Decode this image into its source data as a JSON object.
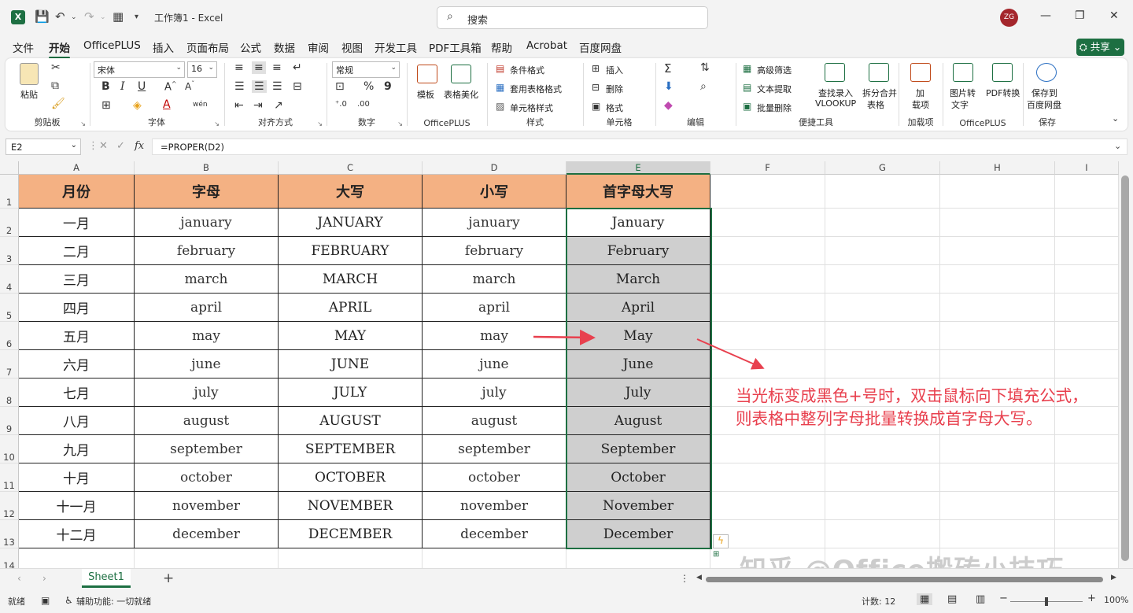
{
  "app": {
    "title": "工作簿1  -  Excel",
    "avatar": "ZG",
    "search_placeholder": "搜索"
  },
  "menus": [
    "文件",
    "开始",
    "OfficePLUS",
    "插入",
    "页面布局",
    "公式",
    "数据",
    "审阅",
    "视图",
    "开发工具",
    "PDF工具箱",
    "帮助",
    "Acrobat",
    "百度网盘"
  ],
  "share_label": "共享",
  "ribbon": {
    "clipboard": {
      "paste": "粘贴",
      "label": "剪贴板"
    },
    "font": {
      "name": "宋体",
      "size": "16",
      "label": "字体"
    },
    "align": {
      "label": "对齐方式"
    },
    "number": {
      "format": "常规",
      "label": "数字"
    },
    "officeplus": {
      "template": "模板",
      "beautify": "表格美化",
      "label": "OfficePLUS"
    },
    "style": {
      "cond": "条件格式",
      "table": "套用表格格式",
      "cell": "单元格样式",
      "label": "样式"
    },
    "cells": {
      "insert": "插入",
      "delete": "删除",
      "format": "格式",
      "label": "单元格"
    },
    "edit": {
      "label": "编辑"
    },
    "tools": {
      "advfilter": "高级筛选",
      "textextract": "文本提取",
      "batchdelete": "批量删除",
      "lookup1": "查找录入",
      "lookup2": "VLOOKUP",
      "split1": "拆分合并",
      "split2": "表格",
      "label": "便捷工具"
    },
    "addin": {
      "l1": "加",
      "l2": "载项",
      "label": "加载项"
    },
    "op2": {
      "img1": "图片转",
      "img2": "文字",
      "pdf": "PDF转换",
      "label": "OfficePLUS"
    },
    "save": {
      "l1": "保存到",
      "l2": "百度网盘",
      "label": "保存"
    }
  },
  "formula_bar": {
    "name_box": "E2",
    "formula": "=PROPER(D2)"
  },
  "columns": [
    "A",
    "B",
    "C",
    "D",
    "E",
    "F",
    "G",
    "H",
    "I"
  ],
  "rows": [
    "1",
    "2",
    "3",
    "4",
    "5",
    "6",
    "7",
    "8",
    "9",
    "10",
    "11",
    "12",
    "13",
    "14"
  ],
  "table": {
    "headers": [
      "月份",
      "字母",
      "大写",
      "小写",
      "首字母大写"
    ],
    "rows": [
      [
        "一月",
        "january",
        "JANUARY",
        "january",
        "January"
      ],
      [
        "二月",
        "february",
        "FEBRUARY",
        "february",
        "February"
      ],
      [
        "三月",
        "march",
        "MARCH",
        "march",
        "March"
      ],
      [
        "四月",
        "april",
        "APRIL",
        "april",
        "April"
      ],
      [
        "五月",
        "may",
        "MAY",
        "may",
        "May"
      ],
      [
        "六月",
        "june",
        "JUNE",
        "june",
        "June"
      ],
      [
        "七月",
        "july",
        "JULY",
        "july",
        "July"
      ],
      [
        "八月",
        "august",
        "AUGUST",
        "august",
        "August"
      ],
      [
        "九月",
        "september",
        "SEPTEMBER",
        "september",
        "September"
      ],
      [
        "十月",
        "october",
        "OCTOBER",
        "october",
        "October"
      ],
      [
        "十一月",
        "november",
        "NOVEMBER",
        "november",
        "November"
      ],
      [
        "十二月",
        "december",
        "DECEMBER",
        "december",
        "December"
      ]
    ]
  },
  "annotation": {
    "line1": "当光标变成黑色+号时，双击鼠标向下填充公式，",
    "line2": "则表格中整列字母批量转换成首字母大写。"
  },
  "watermark": "知乎 @Office搬砖小技巧",
  "sheet_tab": "Sheet1",
  "status": {
    "ready": "就绪",
    "accessibility": "辅助功能: 一切就绪",
    "count": "计数: 12",
    "zoom": "100%"
  },
  "colors": {
    "header_fill": "#f4b183",
    "accent": "#1d6f42",
    "annotation": "#e8404e"
  }
}
